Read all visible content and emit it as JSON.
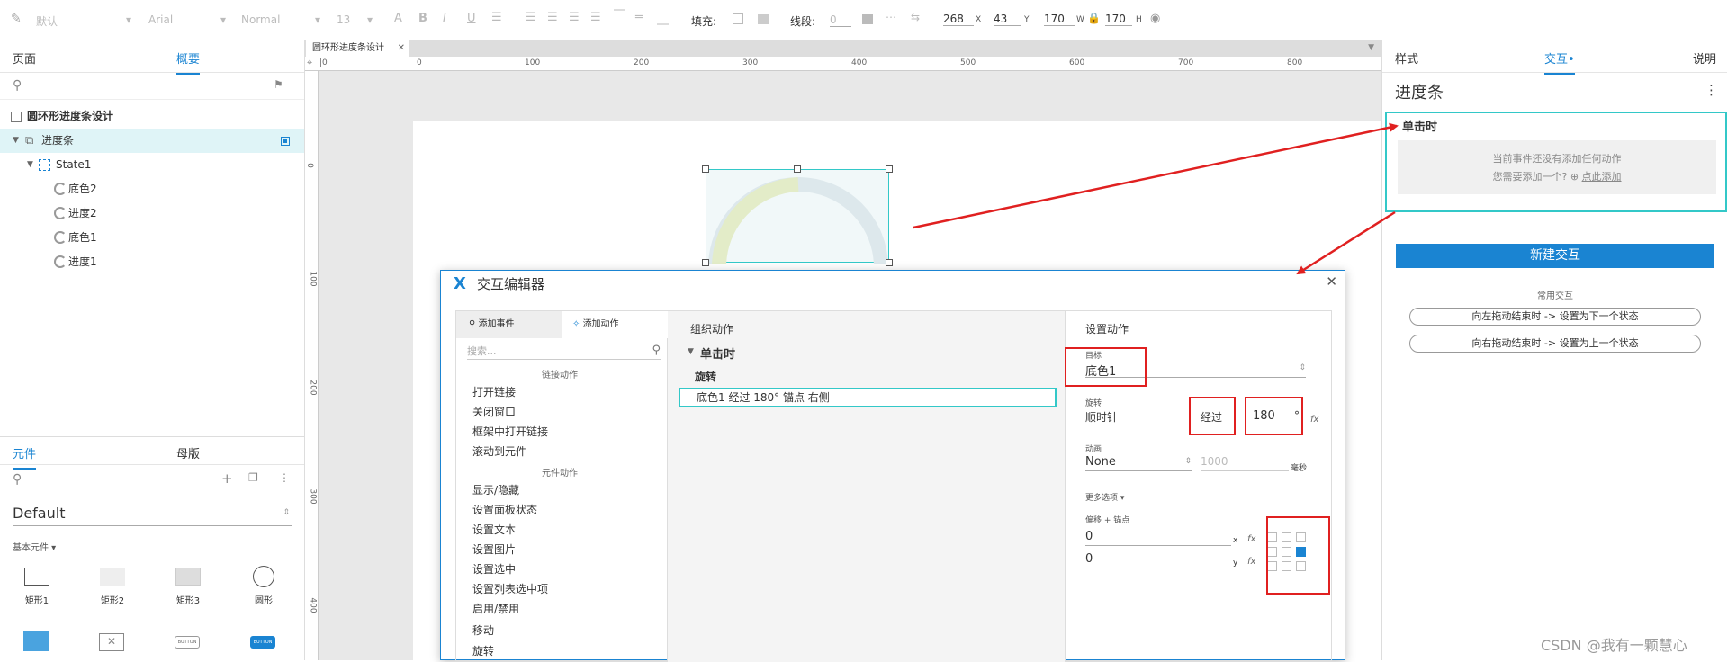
{
  "toolbar": {
    "style_default": "默认",
    "font": "Arial",
    "weight": "Normal",
    "size": "13",
    "fill_label": "填充:",
    "stroke_label": "线段:",
    "stroke_value": "0",
    "x": "268",
    "y": "43",
    "w": "170",
    "h": "170",
    "x_label": "X",
    "y_label": "Y",
    "w_label": "W",
    "h_label": "H"
  },
  "left": {
    "tab_pages": "页面",
    "tab_outline": "概要",
    "tree": {
      "root": "圆环形进度条设计",
      "item": "进度条",
      "state": "State1",
      "children": [
        "底色2",
        "进度2",
        "底色1",
        "进度1"
      ]
    },
    "lib_tab1": "元件",
    "lib_tab2": "母版",
    "lib_select": "Default",
    "lib_category": "基本元件 ▾",
    "lib_items": [
      "矩形1",
      "矩形2",
      "矩形3",
      "圆形"
    ],
    "lib_btn_text": "BUTTON"
  },
  "canvas": {
    "tab": "圆环形进度条设计",
    "ruler_h": [
      "0",
      "100",
      "200",
      "300",
      "400",
      "500",
      "600",
      "700",
      "800"
    ],
    "ruler_v": [
      "0",
      "100",
      "200",
      "300",
      "400"
    ]
  },
  "right": {
    "tab_style": "样式",
    "tab_interact": "交互•",
    "tab_notes": "说明",
    "title": "进度条",
    "event": "单击时",
    "empty_line1": "当前事件还没有添加任何动作",
    "empty_line2": "您需要添加一个?",
    "empty_link": "点此添加",
    "new_btn": "新建交互",
    "common": "常用交互",
    "btn1": "向左拖动结束时 -> 设置为下一个状态",
    "btn2": "向右拖动结束时 -> 设置为上一个状态"
  },
  "dialog": {
    "title": "交互编辑器",
    "tab_event": "添加事件",
    "tab_action": "添加动作",
    "search": "搜索...",
    "sec_link": "链接动作",
    "link_actions": [
      "打开链接",
      "关闭窗口",
      "框架中打开链接",
      "滚动到元件"
    ],
    "sec_widget": "元件动作",
    "widget_actions": [
      "显示/隐藏",
      "设置面板状态",
      "设置文本",
      "设置图片",
      "设置选中",
      "设置列表选中项",
      "启用/禁用",
      "移动",
      "旋转"
    ],
    "org_title": "组织动作",
    "org_event": "单击时",
    "org_action": "旋转",
    "org_detail": "底色1 经过 180° 锚点 右侧",
    "set_title": "设置动作",
    "target_label": "目标",
    "target": "底色1",
    "rotate_label": "旋转",
    "direction": "顺时针",
    "mode": "经过",
    "degrees": "180",
    "deg_unit": "°",
    "anim_label": "动画",
    "anim": "None",
    "duration": "1000",
    "ms": "毫秒",
    "more": "更多选项 ▾",
    "offset_label": "偏移 + 锚点",
    "offset_x": "0",
    "offset_y": "0",
    "x": "x",
    "y": "y"
  },
  "watermark": "CSDN @我有一颗慧心",
  "colors": {
    "accent": "#1a84d2",
    "highlight": "#33c8c8",
    "red": "#e02020"
  }
}
